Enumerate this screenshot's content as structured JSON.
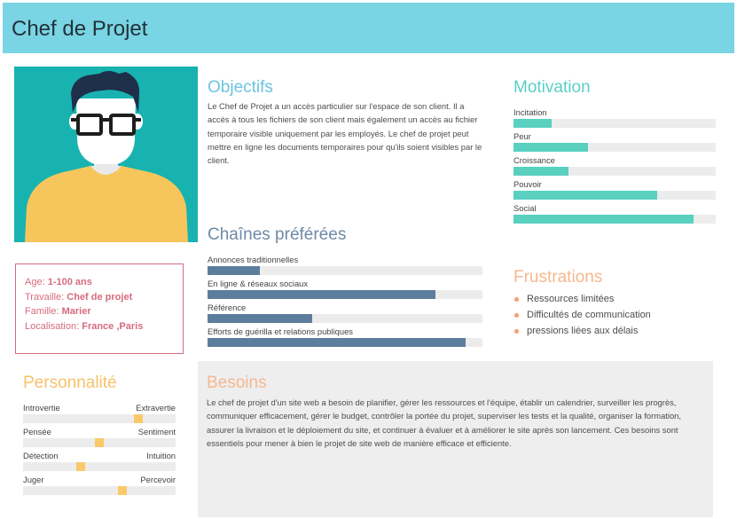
{
  "header": {
    "title": "Chef de Projet"
  },
  "profile": {
    "age_label": "Age:",
    "age_value": "1-100 ans",
    "work_label": "Travaille:",
    "work_value": "Chef de projet",
    "family_label": "Famille:",
    "family_value": "Marier",
    "location_label": "Localisation:",
    "location_value": "France ,Paris"
  },
  "objectives": {
    "title": "Objectifs",
    "text": "Le Chef de Projet a un accès particulier sur l'espace de son client. Il a accès à tous les fichiers de son client mais également un accès au fichier temporaire visible uniquement par les employés. Le chef de projet peut mettre en ligne les documents temporaires pour qu'ils soient visibles par le client."
  },
  "motivation": {
    "title": "Motivation",
    "items": [
      {
        "label": "Incitation",
        "level": 0.19
      },
      {
        "label": "Peur",
        "level": 0.37
      },
      {
        "label": "Croissance",
        "level": 0.27
      },
      {
        "label": "Pouvoir",
        "level": 0.71
      },
      {
        "label": "Social",
        "level": 0.89
      }
    ]
  },
  "channels": {
    "title": "Chaînes préférées",
    "items": [
      {
        "label": "Annonces traditionnelles",
        "level": 0.19
      },
      {
        "label": " En ligne & réseaux sociaux",
        "level": 0.83
      },
      {
        "label": "Référence",
        "level": 0.38
      },
      {
        "label": "Efforts de guérilla et relations publiques",
        "level": 0.94
      }
    ]
  },
  "frustrations": {
    "title": "Frustrations",
    "items": [
      " Ressources limitées",
      "Difficultés de communication",
      " pressions liées aux délais"
    ]
  },
  "personality": {
    "title": "Personnalité",
    "items": [
      {
        "left": "Introvertie",
        "right": "Extravertie",
        "level": 0.77
      },
      {
        "left": "Pensée",
        "right": "Sentiment",
        "level": 0.5
      },
      {
        "left": "Détection",
        "right": "Intuition",
        "level": 0.37
      },
      {
        "left": "Juger",
        "right": "Percevoir",
        "level": 0.66
      }
    ]
  },
  "needs": {
    "title": "Besoins",
    "text": "Le chef de projet d'un site web a besoin de planifier, gérer les ressources et l'équipe, établir un calendrier, surveiller les progrès, communiquer efficacement, gérer le budget, contrôler la portée du projet, superviser les tests et la qualité, organiser la formation, assurer la livraison et le déploiement du site, et continuer à évaluer et à améliorer le site après son lancement. Ces besoins sont essentiels pour mener à bien le projet de site web de manière efficace et efficiente."
  },
  "colors": {
    "header_bg": "#79d4e3",
    "avatar_bg": "#18b3b0",
    "motivation_bar": "#59d0c0",
    "channel_bar": "#5d7d9d",
    "personality_marker": "#f9c96a",
    "profile_accent": "#d66c7e"
  }
}
